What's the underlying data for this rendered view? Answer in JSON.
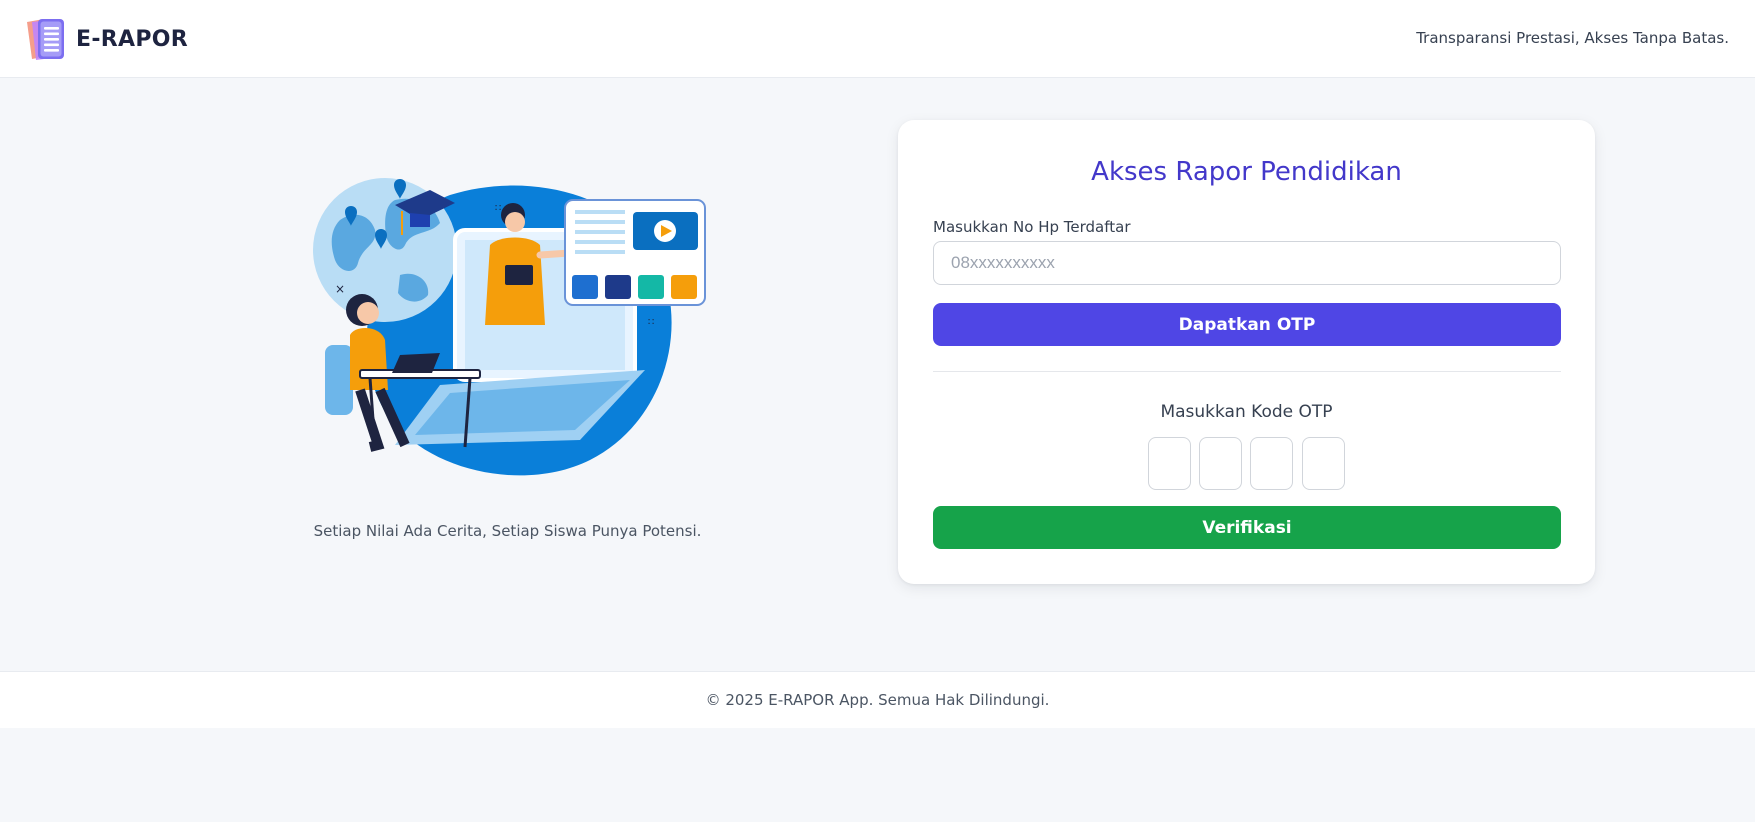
{
  "colors": {
    "background": "#f5f7fa",
    "brand_text": "#1e2440",
    "title": "#4338ca",
    "otp_button": "#4f46e5",
    "verify_button": "#16a34a",
    "logo": "#8b7cf0"
  },
  "header": {
    "brand_name": "E-RAPOR",
    "logo_icon": "document-list-icon",
    "tagline": "Transparansi Prestasi, Akses Tanpa Batas."
  },
  "hero": {
    "illustration": "online-learning-illustration",
    "caption": "Setiap Nilai Ada Cerita, Setiap Siswa Punya Potensi."
  },
  "login_card": {
    "title": "Akses Rapor Pendidikan",
    "phone_label": "Masukkan No Hp Terdaftar",
    "phone_placeholder": "08xxxxxxxxxx",
    "phone_value": "",
    "get_otp_label": "Dapatkan OTP",
    "otp_label": "Masukkan Kode OTP",
    "otp_digits": [
      "",
      "",
      "",
      ""
    ],
    "verify_label": "Verifikasi"
  },
  "footer": {
    "copyright": "© 2025 E-RAPOR App. Semua Hak Dilindungi."
  }
}
